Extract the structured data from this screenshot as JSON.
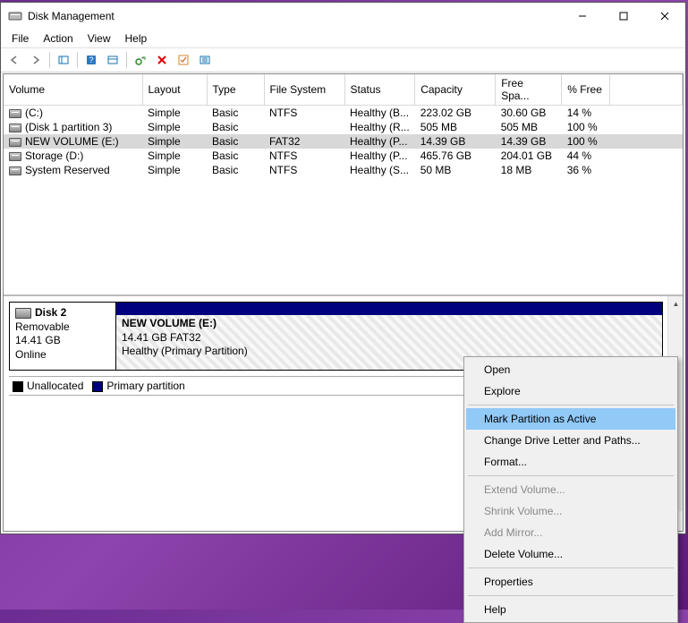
{
  "window": {
    "title": "Disk Management",
    "min_label": "—",
    "max_label": "☐",
    "close_label": "✕"
  },
  "menubar": {
    "file": "File",
    "action": "Action",
    "view": "View",
    "help": "Help"
  },
  "columns": {
    "volume": "Volume",
    "layout": "Layout",
    "type": "Type",
    "fs": "File System",
    "status": "Status",
    "capacity": "Capacity",
    "free": "Free Spa...",
    "pct": "% Free"
  },
  "volumes": [
    {
      "name": "(C:)",
      "layout": "Simple",
      "type": "Basic",
      "fs": "NTFS",
      "status": "Healthy (B...",
      "capacity": "223.02 GB",
      "free": "30.60 GB",
      "pct": "14 %",
      "selected": false
    },
    {
      "name": "(Disk 1 partition 3)",
      "layout": "Simple",
      "type": "Basic",
      "fs": "",
      "status": "Healthy (R...",
      "capacity": "505 MB",
      "free": "505 MB",
      "pct": "100 %",
      "selected": false
    },
    {
      "name": "NEW VOLUME (E:)",
      "layout": "Simple",
      "type": "Basic",
      "fs": "FAT32",
      "status": "Healthy (P...",
      "capacity": "14.39 GB",
      "free": "14.39 GB",
      "pct": "100 %",
      "selected": true
    },
    {
      "name": "Storage (D:)",
      "layout": "Simple",
      "type": "Basic",
      "fs": "NTFS",
      "status": "Healthy (P...",
      "capacity": "465.76 GB",
      "free": "204.01 GB",
      "pct": "44 %",
      "selected": false
    },
    {
      "name": "System Reserved",
      "layout": "Simple",
      "type": "Basic",
      "fs": "NTFS",
      "status": "Healthy (S...",
      "capacity": "50 MB",
      "free": "18 MB",
      "pct": "36 %",
      "selected": false
    }
  ],
  "disk": {
    "name": "Disk 2",
    "media": "Removable",
    "size": "14.41 GB",
    "state": "Online",
    "partition": {
      "label": "NEW VOLUME  (E:)",
      "detail": "14.41 GB FAT32",
      "status": "Healthy (Primary Partition)"
    }
  },
  "legend": {
    "unallocated": "Unallocated",
    "primary": "Primary partition"
  },
  "context_menu": {
    "open": "Open",
    "explore": "Explore",
    "mark_active": "Mark Partition as Active",
    "change_letter": "Change Drive Letter and Paths...",
    "format": "Format...",
    "extend": "Extend Volume...",
    "shrink": "Shrink Volume...",
    "add_mirror": "Add Mirror...",
    "delete": "Delete Volume...",
    "properties": "Properties",
    "help": "Help"
  },
  "icons": {
    "back": "back-icon",
    "forward": "forward-icon",
    "show_hide": "show-hide-tree-icon",
    "help": "help-icon",
    "properties": "properties-icon",
    "refresh": "refresh-icon",
    "delete": "delete-icon",
    "check": "check-icon",
    "list": "list-icon"
  }
}
